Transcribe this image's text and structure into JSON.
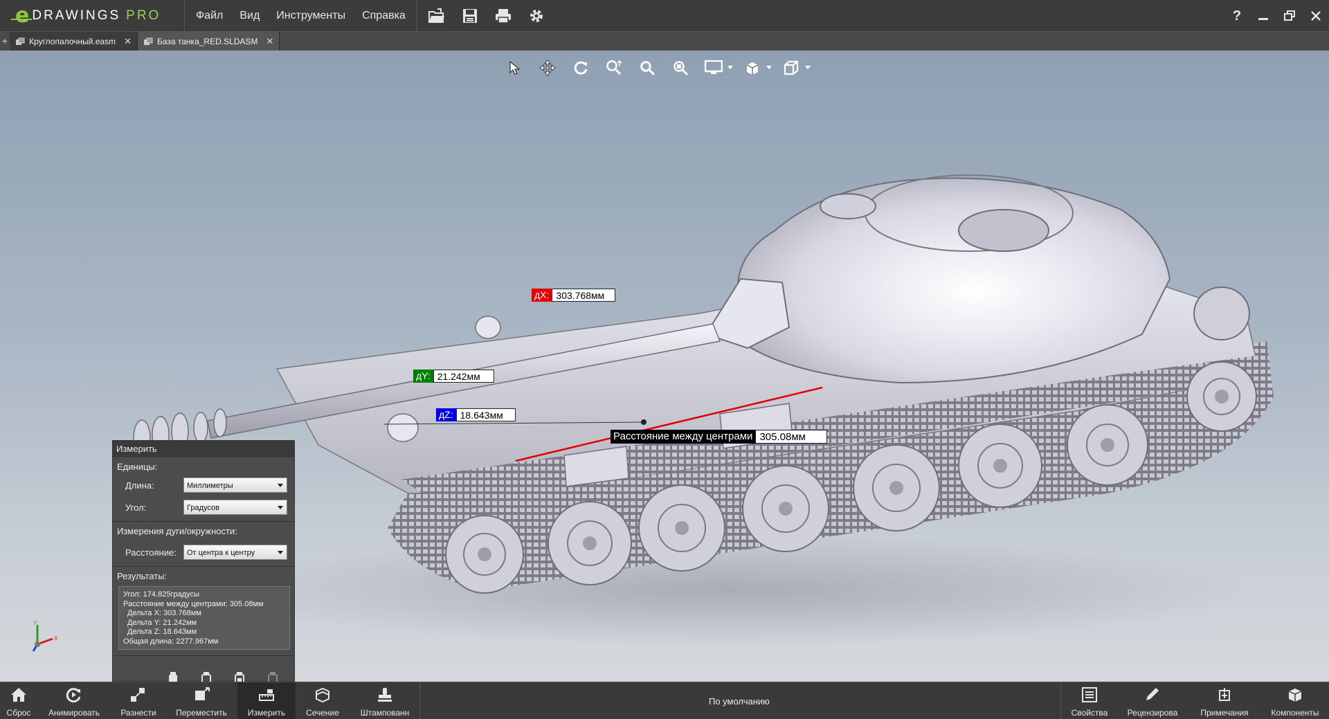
{
  "app": {
    "brand": "DRAWINGS",
    "brand_pro": "PRO",
    "brand_e": "e"
  },
  "menu": {
    "file": "Файл",
    "view": "Вид",
    "tools": "Инструменты",
    "help": "Справка"
  },
  "toolbar_icons": [
    "open-icon",
    "save-icon",
    "print-icon",
    "settings-icon"
  ],
  "window": {
    "help": "?"
  },
  "tabs": [
    {
      "label": "Круглопалочный.easm",
      "close": "✕"
    },
    {
      "label": "База танка_RED.SLDASM",
      "close": "✕"
    }
  ],
  "tab_add": "+",
  "view_toolbar": [
    "select-icon",
    "pan-icon",
    "rotate-icon",
    "zoom-icon",
    "zoom-area-icon",
    "zoom-fit-icon",
    "display-style-icon",
    "section-view-icon",
    "standard-views-icon"
  ],
  "measurements": {
    "dx": {
      "tag": "дX:",
      "value": "303.768мм",
      "color": "#e00000"
    },
    "dy": {
      "tag": "дY:",
      "value": "21.242мм",
      "color": "#008000"
    },
    "dz": {
      "tag": "дZ:",
      "value": "18.643мм",
      "color": "#0000e0"
    },
    "distance": {
      "tag": "Расстояние между центрами",
      "value": "305.08мм"
    }
  },
  "measure_panel": {
    "title": "Измерить",
    "units_title": "Единицы:",
    "length_label": "Длина:",
    "length_value": "Миллиметры",
    "angle_label": "Угол:",
    "angle_value": "Градусов",
    "arc_title": "Измерения дуги/окружности:",
    "distance_label": "Расстояние:",
    "distance_value": "От центра к центру",
    "results_title": "Результаты:",
    "results": [
      "Угол: 174.825градусы",
      "Расстояние между центрами: 305.08мм",
      "Дельта X: 303.768мм",
      "Дельта Y: 21.242мм",
      "Дельта Z: 18.643мм",
      "Общая длина: 2277.967мм"
    ]
  },
  "bottom_bar": {
    "reset": "Сброс",
    "animate": "Анимировать",
    "explode": "Разнести",
    "move": "Переместить",
    "measure": "Измерить",
    "section": "Сечение",
    "stamp": "Штампованн",
    "config": "По умолчанию",
    "properties": "Свойства",
    "review": "Рецензирова",
    "notes": "Примечания",
    "components": "Компоненты"
  },
  "triad": {
    "x": "X",
    "y": "Y"
  }
}
